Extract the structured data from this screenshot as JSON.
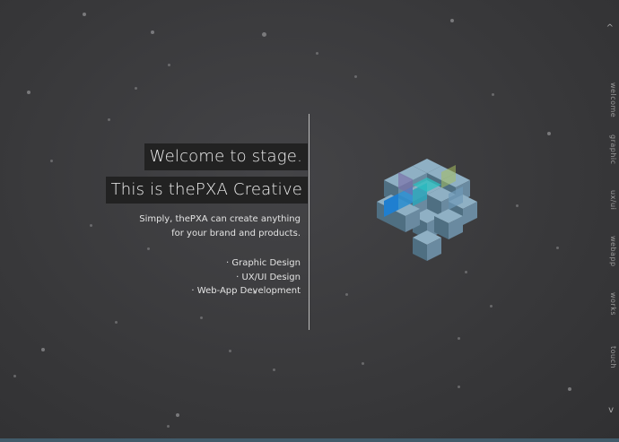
{
  "hero": {
    "title_line1": "Welcome to stage.",
    "title_line2": "This is thePXA Creative",
    "intro_line1": "Simply, thePXA can create anything",
    "intro_line2": "for your brand and products."
  },
  "services": [
    "· Graphic Design",
    "· UX/UI Design",
    "· Web-App Development"
  ],
  "sidenav": {
    "up_arrow": "^",
    "down_arrow": "v",
    "items": [
      "welcome",
      "graphic",
      "ux/ui",
      "webapp",
      "works",
      "touch"
    ]
  },
  "colors": {
    "background": "#3a3a3c",
    "title_box": "#222222",
    "accent_bar": "#415b6a"
  }
}
